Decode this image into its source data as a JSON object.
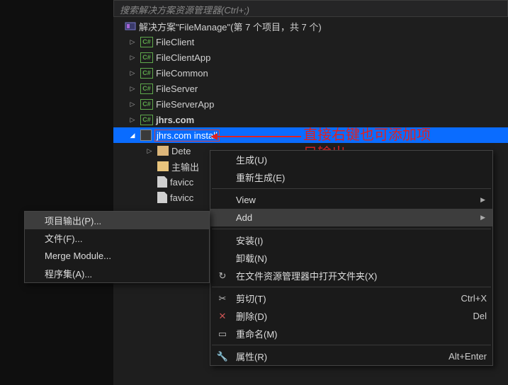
{
  "search_placeholder": "搜索解决方案资源管理器(Ctrl+;)",
  "solution_label": "解决方案\"FileManage\"(第 7 个项目，共 7 个)",
  "projects": {
    "p0": "FileClient",
    "p1": "FileClientApp",
    "p2": "FileCommon",
    "p3": "FileServer",
    "p4": "FileServerApp",
    "p5": "jhrs.com",
    "p6": "jhrs.com install"
  },
  "children": {
    "c0": "Dete",
    "c1": "主输出",
    "c2": "favicc",
    "c3": "favicc"
  },
  "annotation": {
    "line1": "直接右键也可添加项",
    "line2": "目输出"
  },
  "menu": {
    "build": "生成(U)",
    "rebuild": "重新生成(E)",
    "view": "View",
    "add": "Add",
    "install": "安装(I)",
    "unload": "卸载(N)",
    "open_explorer": "在文件资源管理器中打开文件夹(X)",
    "cut": "剪切(T)",
    "cut_sc": "Ctrl+X",
    "delete": "删除(D)",
    "delete_sc": "Del",
    "rename": "重命名(M)",
    "properties": "属性(R)",
    "properties_sc": "Alt+Enter"
  },
  "submenu": {
    "project_output": "项目输出(P)...",
    "file": "文件(F)...",
    "merge_module": "Merge Module...",
    "assembly": "程序集(A)..."
  }
}
